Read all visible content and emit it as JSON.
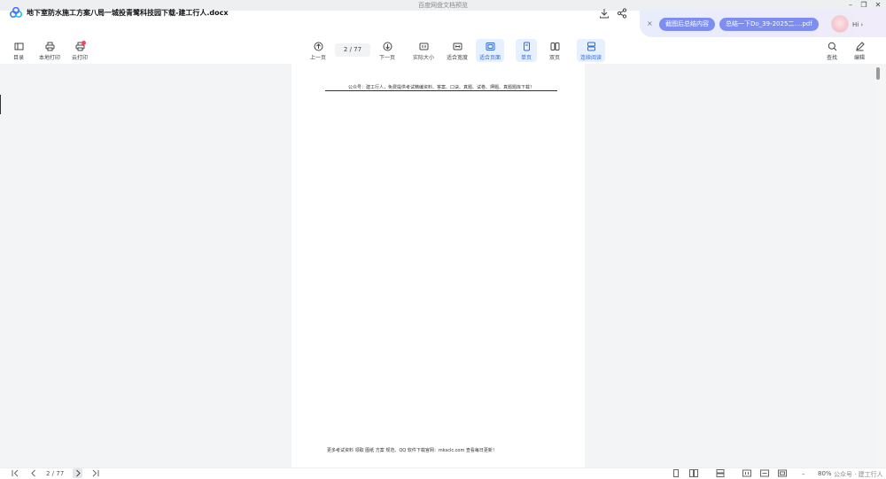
{
  "window": {
    "title": "百度网盘文档预览",
    "minimize": "–",
    "restore": "❐",
    "close": "✕"
  },
  "document": {
    "title": "地下室防水施工方案八局一城投青鹭科技园下载-建工行人.docx"
  },
  "assistant": {
    "close": "×",
    "chip_summary": "截图后总结内容",
    "chip_file": "总结一下Do_39-2025二....pdf",
    "greeting": "Hi ›"
  },
  "toolbar": {
    "toc": "目录",
    "local_print": "本地打印",
    "cloud_print": "云打印",
    "prev_page": "上一页",
    "page_indicator": "2 / 77",
    "next_page": "下一页",
    "actual_size": "实际大小",
    "fit_width": "适合宽度",
    "fit_page": "适合页面",
    "single_page": "单页",
    "double_page": "双页",
    "continuous": "连续阅读",
    "find": "查找",
    "edit": "编辑"
  },
  "page": {
    "header": "公众号：建工行人，免费提供考试精编资料、答案、口诀、真题、试卷、押题、真题题库下载！",
    "footer": "更多考试资料 领取 图纸 方案 规范、QQ 软件下载官网：mksclc.com 查看每日更新！"
  },
  "statusbar": {
    "page_indicator": "2 / 77",
    "zoom": "80%",
    "zoom_in": "+",
    "zoom_out": "–",
    "watermark": "公众号 · 建工行人"
  }
}
